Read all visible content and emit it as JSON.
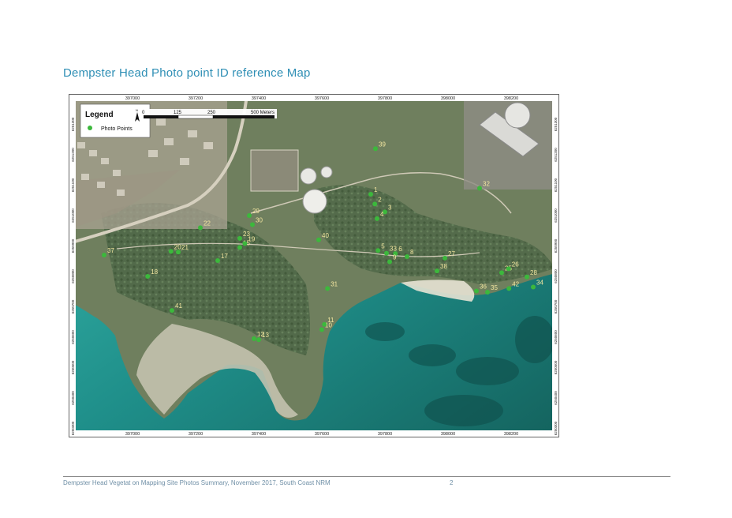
{
  "document": {
    "title": "Dempster Head Photo point ID reference Map",
    "footer_text": "Dempster Head Vegetat on Mapping Site Photos Summary, November 2017, South Coast NRM",
    "page_number": "2"
  },
  "map": {
    "legend": {
      "title": "Legend",
      "item_label": "Photo Points",
      "north_label": "N",
      "scale_labels": [
        "0",
        "125",
        "250",
        "500 Meters"
      ]
    },
    "easting_ticks": [
      "397000",
      "397200",
      "397400",
      "397600",
      "397800",
      "398000",
      "398200"
    ],
    "northing_ticks": [
      "6251300",
      "6251200",
      "6251100",
      "6251000",
      "6250900",
      "6250800",
      "6250700",
      "6250600",
      "6250500",
      "6250400",
      "6250300"
    ],
    "point_color": "#3cb83c",
    "label_color": "#f3e6a0",
    "photo_points": [
      {
        "id": "1",
        "e": 397755,
        "n": 6251070
      },
      {
        "id": "2",
        "e": 397768,
        "n": 6251038
      },
      {
        "id": "3",
        "e": 397800,
        "n": 6251012
      },
      {
        "id": "4",
        "e": 397775,
        "n": 6250990
      },
      {
        "id": "5",
        "e": 397778,
        "n": 6250885
      },
      {
        "id": "6",
        "e": 397833,
        "n": 6250875
      },
      {
        "id": "8",
        "e": 397870,
        "n": 6250865
      },
      {
        "id": "9",
        "e": 397815,
        "n": 6250848
      },
      {
        "id": "10",
        "e": 397600,
        "n": 6250625
      },
      {
        "id": "11",
        "e": 397608,
        "n": 6250642
      },
      {
        "id": "12",
        "e": 397385,
        "n": 6250595
      },
      {
        "id": "13",
        "e": 397400,
        "n": 6250592
      },
      {
        "id": "15",
        "e": 397340,
        "n": 6250895
      },
      {
        "id": "17",
        "e": 397270,
        "n": 6250852
      },
      {
        "id": "18",
        "e": 397048,
        "n": 6250800
      },
      {
        "id": "19",
        "e": 397356,
        "n": 6250908
      },
      {
        "id": "20",
        "e": 397122,
        "n": 6250882
      },
      {
        "id": "21",
        "e": 397145,
        "n": 6250880
      },
      {
        "id": "22",
        "e": 397215,
        "n": 6250960
      },
      {
        "id": "23",
        "e": 397340,
        "n": 6250925
      },
      {
        "id": "25",
        "e": 398170,
        "n": 6250812
      },
      {
        "id": "26",
        "e": 398192,
        "n": 6250825
      },
      {
        "id": "27",
        "e": 397990,
        "n": 6250860
      },
      {
        "id": "28",
        "e": 398250,
        "n": 6250798
      },
      {
        "id": "29",
        "e": 397370,
        "n": 6251000
      },
      {
        "id": "30",
        "e": 397380,
        "n": 6250970
      },
      {
        "id": "31",
        "e": 397618,
        "n": 6250760
      },
      {
        "id": "32",
        "e": 398100,
        "n": 6251090
      },
      {
        "id": "33",
        "e": 397805,
        "n": 6250876
      },
      {
        "id": "34",
        "e": 398270,
        "n": 6250765
      },
      {
        "id": "35",
        "e": 398125,
        "n": 6250748
      },
      {
        "id": "36",
        "e": 398090,
        "n": 6250752
      },
      {
        "id": "37",
        "e": 396910,
        "n": 6250870
      },
      {
        "id": "38",
        "e": 397965,
        "n": 6250818
      },
      {
        "id": "39",
        "e": 397770,
        "n": 6251220
      },
      {
        "id": "40",
        "e": 397590,
        "n": 6250920
      },
      {
        "id": "41",
        "e": 397125,
        "n": 6250688
      },
      {
        "id": "42",
        "e": 398193,
        "n": 6250760
      }
    ]
  }
}
